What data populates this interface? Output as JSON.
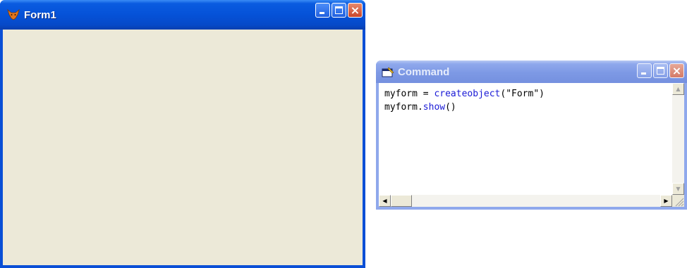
{
  "form1": {
    "title": "Form1",
    "icon": "fox-app-icon"
  },
  "command_window": {
    "title": "Command",
    "icon": "command-window-icon",
    "code_lines": [
      {
        "parts": [
          {
            "text": "myform = ",
            "kw": false
          },
          {
            "text": "createobject",
            "kw": true
          },
          {
            "text": "(\"Form\")",
            "kw": false
          }
        ]
      },
      {
        "parts": [
          {
            "text": "myform.",
            "kw": false
          },
          {
            "text": "show",
            "kw": true
          },
          {
            "text": "()",
            "kw": false
          }
        ]
      }
    ]
  },
  "controls": {
    "minimize": "minimize-icon",
    "maximize": "maximize-icon",
    "close_glyph": "×"
  },
  "colors": {
    "active_title": "#0552d8",
    "inactive_title": "#7d99e5",
    "form_background": "#ece9d8",
    "keyword": "#1a1ad6"
  }
}
